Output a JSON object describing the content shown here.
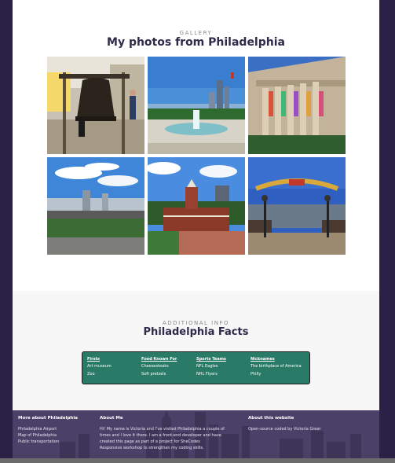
{
  "gallery": {
    "eyebrow": "GALLERY",
    "title": "My photos from Philadelphia",
    "photos": [
      {
        "subject": "liberty-bell"
      },
      {
        "subject": "fountain-skyline"
      },
      {
        "subject": "art-museum-banners"
      },
      {
        "subject": "highway-skyline"
      },
      {
        "subject": "independence-hall"
      },
      {
        "subject": "arch-street"
      }
    ]
  },
  "facts": {
    "eyebrow": "ADDITIONAL INFO",
    "title": "Philadelphia Facts",
    "columns": [
      {
        "header": "Firsts",
        "cells": [
          "Art museum",
          "Zoo"
        ]
      },
      {
        "header": "Food Known For",
        "cells": [
          "Cheesesteaks",
          "Soft pretzels"
        ]
      },
      {
        "header": "Sports Teams",
        "cells": [
          "NFL Eagles",
          "NHL Flyers"
        ]
      },
      {
        "header": "Nicknames",
        "cells": [
          "The birthplace of America",
          "Philly"
        ]
      }
    ],
    "colors": {
      "table_bg": "#2a7a68"
    }
  },
  "footer": {
    "more": {
      "title": "More about Philadelphia",
      "links": [
        "Philadelphia Airport",
        "Map of Philadelphia",
        "Public transportation"
      ]
    },
    "about_me": {
      "title": "About Me",
      "lines": [
        "Hi! My name is Victoria and I've visited Philadelphia a couple of",
        "times and I love it there. I am a front-end developer and have",
        "created this page as part of a project for SheCodes",
        "Responsive workshop to strengthen my coding skills."
      ]
    },
    "about_site": {
      "title": "About this website",
      "text": "Open-source coded by Victoria Greer"
    }
  }
}
